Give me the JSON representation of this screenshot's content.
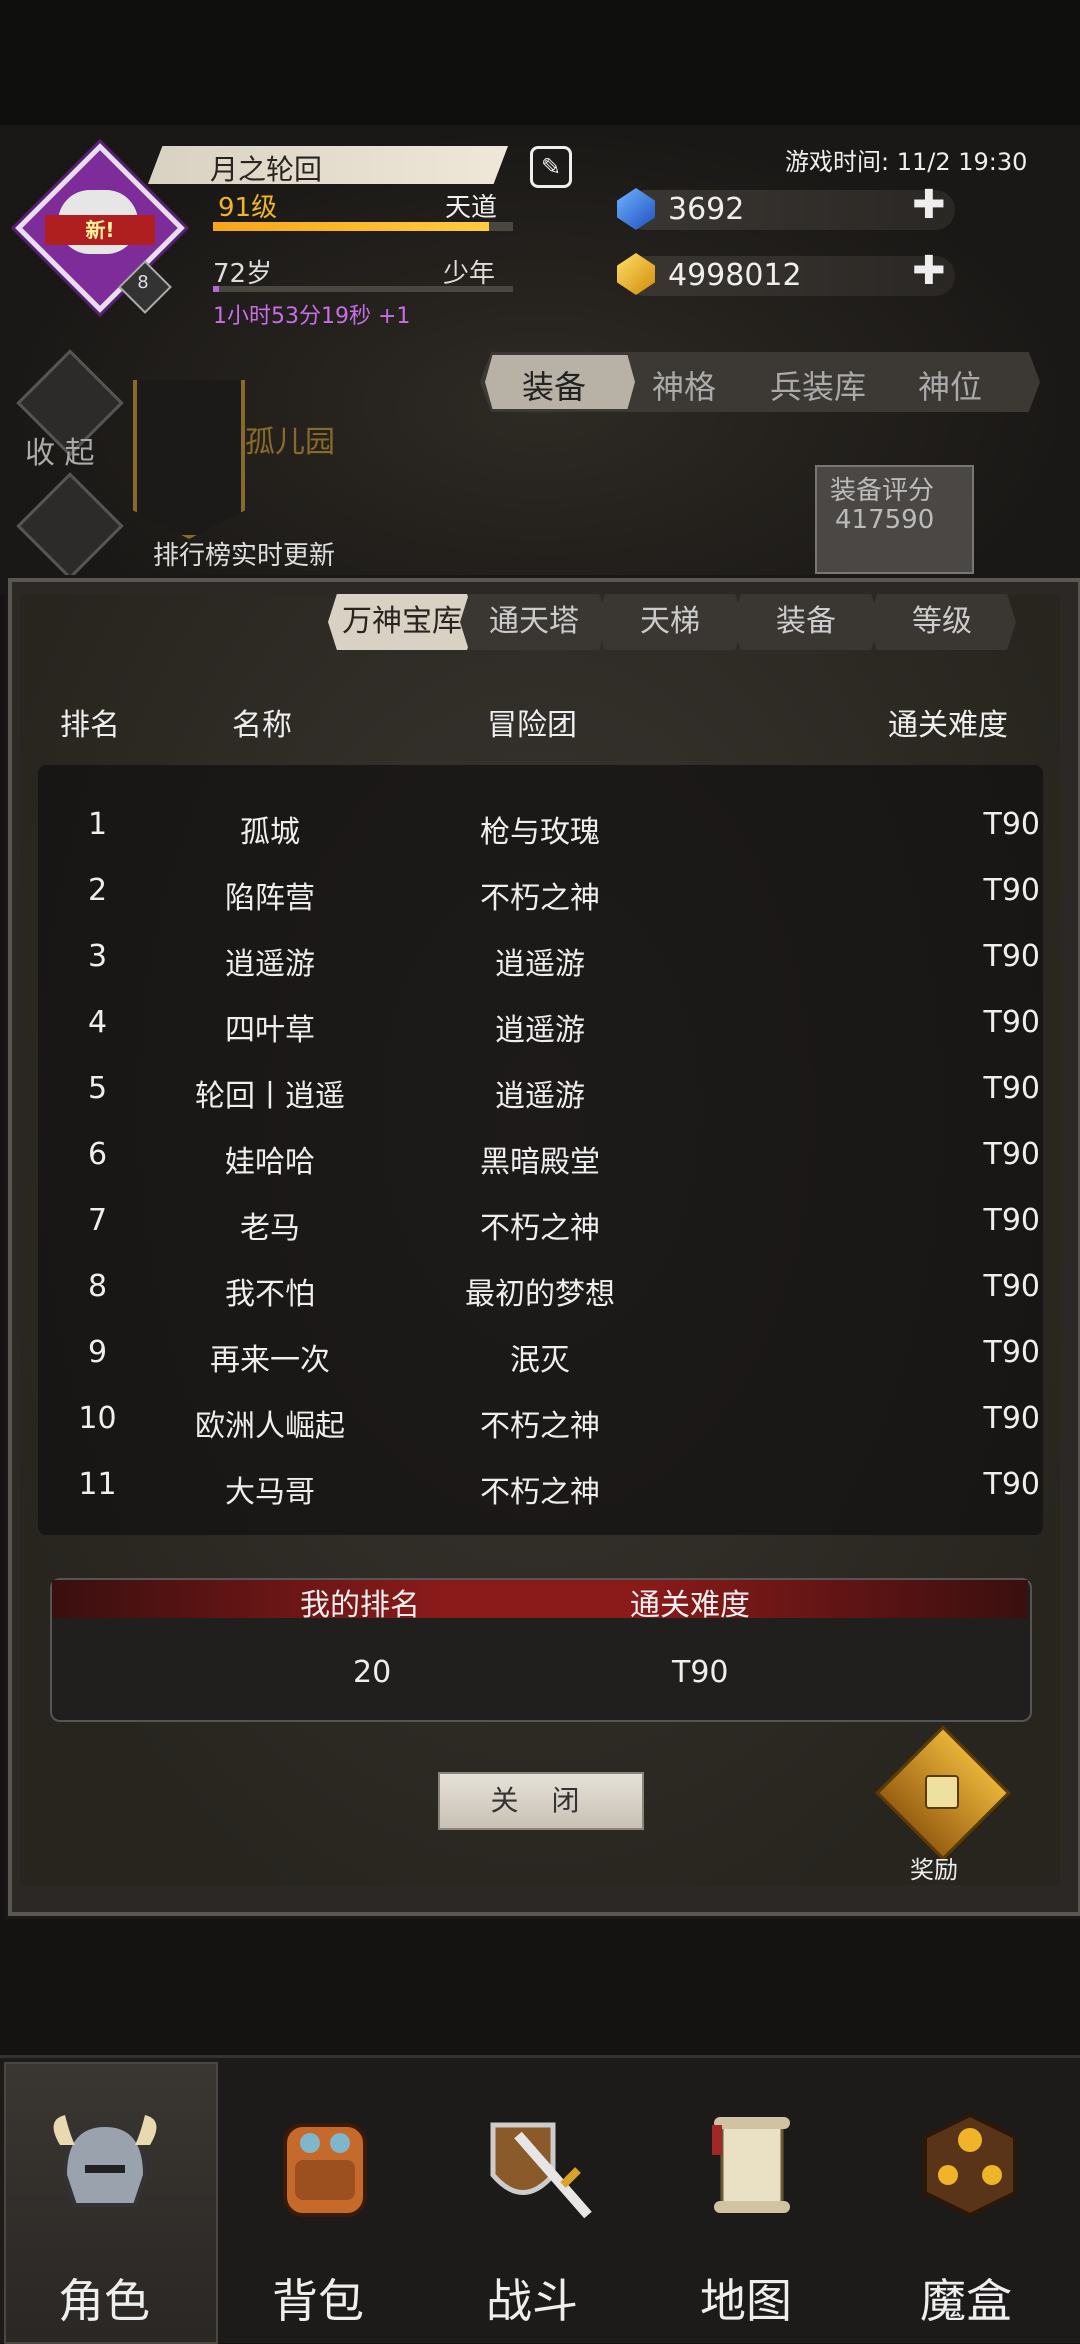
{
  "player": {
    "name": "月之轮回",
    "level": "91级",
    "realm": "天道",
    "age": "72岁",
    "stage": "少年",
    "timer": "1小时53分19秒 +1",
    "badge_new": "新!",
    "badge_level": "8",
    "exp_fraction": 0.92,
    "age_fraction": 0.02
  },
  "game_time": "游戏时间: 11/2 19:30",
  "resources": {
    "diamonds": "3692",
    "gold": "4998012"
  },
  "side": {
    "collapse": "收 起"
  },
  "top_tabs": [
    "装备",
    "神格",
    "兵装库",
    "神位"
  ],
  "guild_banner": "孤儿园",
  "rank_note": "排行榜实时更新",
  "equip_score": {
    "label": "装备评分",
    "value": "417590"
  },
  "modal": {
    "tabs": [
      "万神宝库",
      "通天塔",
      "天梯",
      "装备",
      "等级"
    ],
    "active_tab": 0,
    "columns": [
      "排名",
      "名称",
      "冒险团",
      "通关难度"
    ],
    "rows": [
      {
        "rank": "1",
        "name": "孤城",
        "team": "枪与玫瑰",
        "diff": "T90"
      },
      {
        "rank": "2",
        "name": "陷阵营",
        "team": "不朽之神",
        "diff": "T90"
      },
      {
        "rank": "3",
        "name": "逍遥游",
        "team": "逍遥游",
        "diff": "T90"
      },
      {
        "rank": "4",
        "name": "四叶草",
        "team": "逍遥游",
        "diff": "T90"
      },
      {
        "rank": "5",
        "name": "轮回丨逍遥",
        "team": "逍遥游",
        "diff": "T90"
      },
      {
        "rank": "6",
        "name": "娃哈哈",
        "team": "黑暗殿堂",
        "diff": "T90"
      },
      {
        "rank": "7",
        "name": "老马",
        "team": "不朽之神",
        "diff": "T90"
      },
      {
        "rank": "8",
        "name": "我不怕",
        "team": "最初的梦想",
        "diff": "T90"
      },
      {
        "rank": "9",
        "name": "再来一次",
        "team": "泯灭",
        "diff": "T90"
      },
      {
        "rank": "10",
        "name": "欧洲人崛起",
        "team": "不朽之神",
        "diff": "T90"
      },
      {
        "rank": "11",
        "name": "大马哥",
        "team": "不朽之神",
        "diff": "T90"
      }
    ],
    "my_rank_label": "我的排名",
    "my_diff_label": "通关难度",
    "my_rank": "20",
    "my_diff": "T90",
    "close": "关 闭",
    "reward": "奖励"
  },
  "nav": [
    "角色",
    "背包",
    "战斗",
    "地图",
    "魔盒"
  ],
  "nav_active": 0
}
